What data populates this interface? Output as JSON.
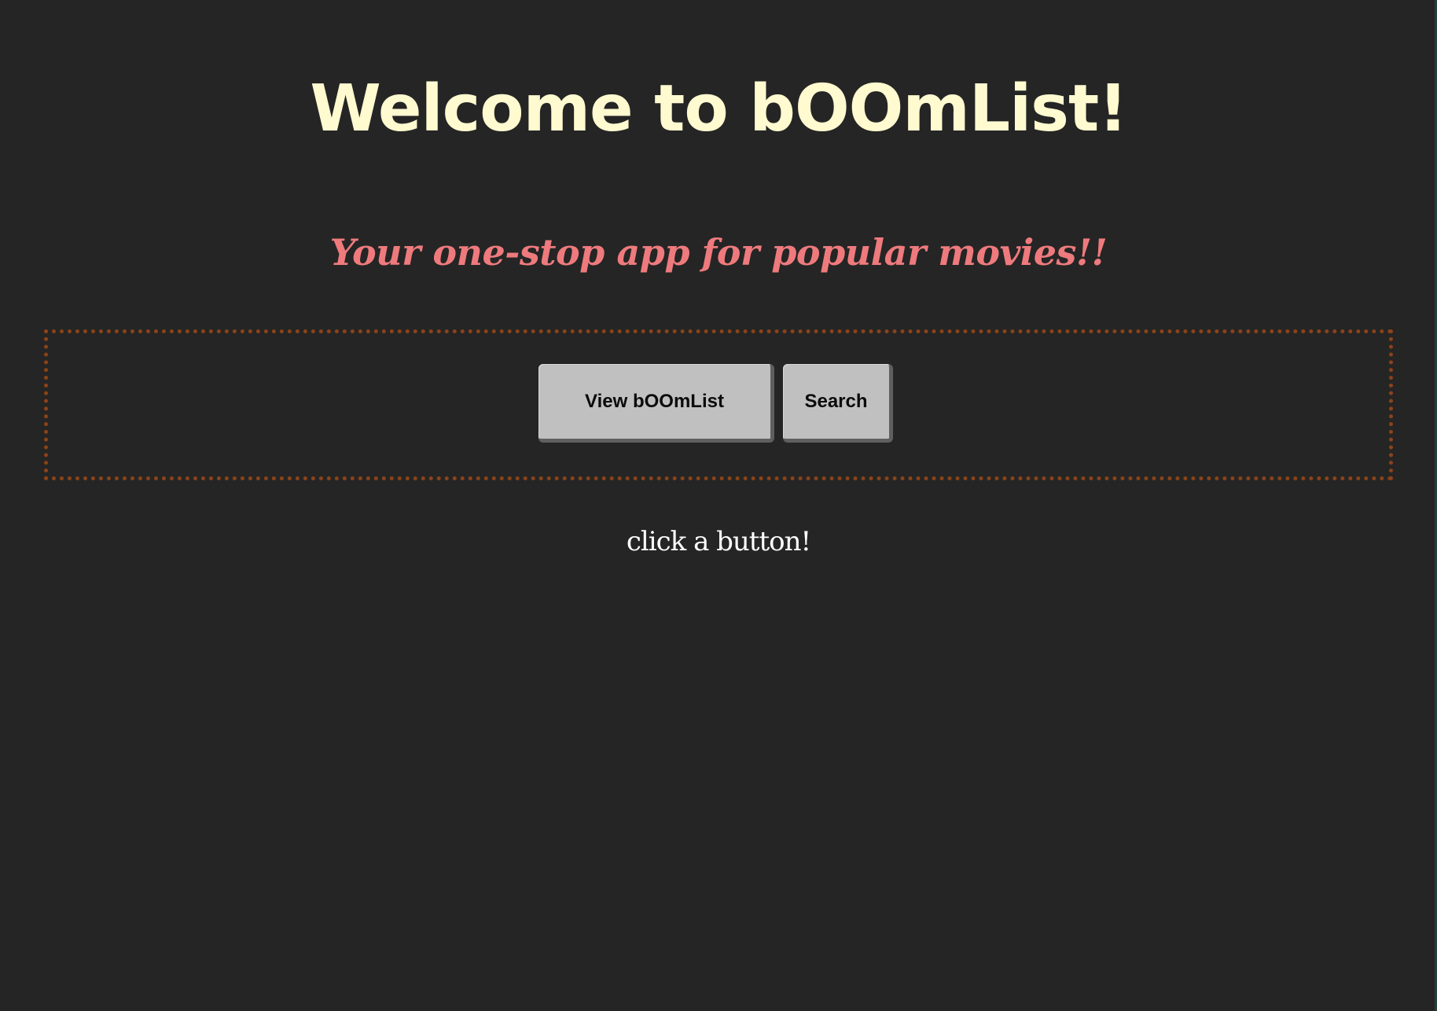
{
  "header": {
    "title": "Welcome to bOOmList!",
    "subtitle": "Your one-stop app for popular movies!!"
  },
  "actions": {
    "view_label": "View bOOmList",
    "search_label": "Search"
  },
  "status": {
    "message": "click a button!"
  },
  "colors": {
    "background": "#252525",
    "title": "#fffad0",
    "subtitle": "#ee7a7d",
    "panel_border": "#8b4318",
    "button": "#c0c0c0"
  }
}
